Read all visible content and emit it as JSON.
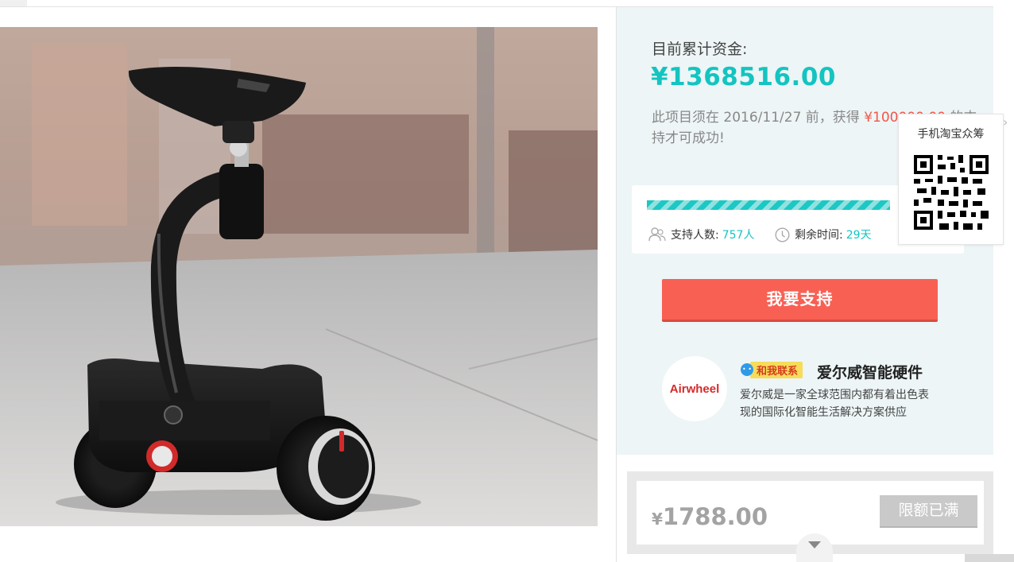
{
  "funding": {
    "label": "目前累计资金:",
    "amount": "¥1368516.00",
    "deadline_text_prefix": "此项目须在 2016/11/27 前，获得 ",
    "target": "¥100000.00",
    "deadline_text_suffix": " 的支持才可成功!"
  },
  "stats": {
    "progress_percent": 100,
    "supporters_label": "支持人数:",
    "supporters_value": "757人",
    "remaining_label": "剩余时间:",
    "remaining_value": "29天"
  },
  "actions": {
    "support_button": "我要支持"
  },
  "project_owner": {
    "logo_text": "Airwheel",
    "contact_badge": "和我联系",
    "name": "爱尔威智能硬件",
    "description": "爱尔威是一家全球范围内都有着出色表现的国际化智能生活解决方案供应"
  },
  "qr_popup": {
    "title": "手机淘宝众筹",
    "close_icon": "chevron-right-icon"
  },
  "reward": {
    "currency": "¥",
    "price": "1788.00",
    "status_button": "限额已满"
  },
  "product_image": {
    "brand_mark": "Airwheel"
  },
  "colors": {
    "accent": "#14c4c0",
    "primary_button": "#f86054",
    "panel_bg": "#edf5f6",
    "disabled": "#c9c9c9"
  }
}
